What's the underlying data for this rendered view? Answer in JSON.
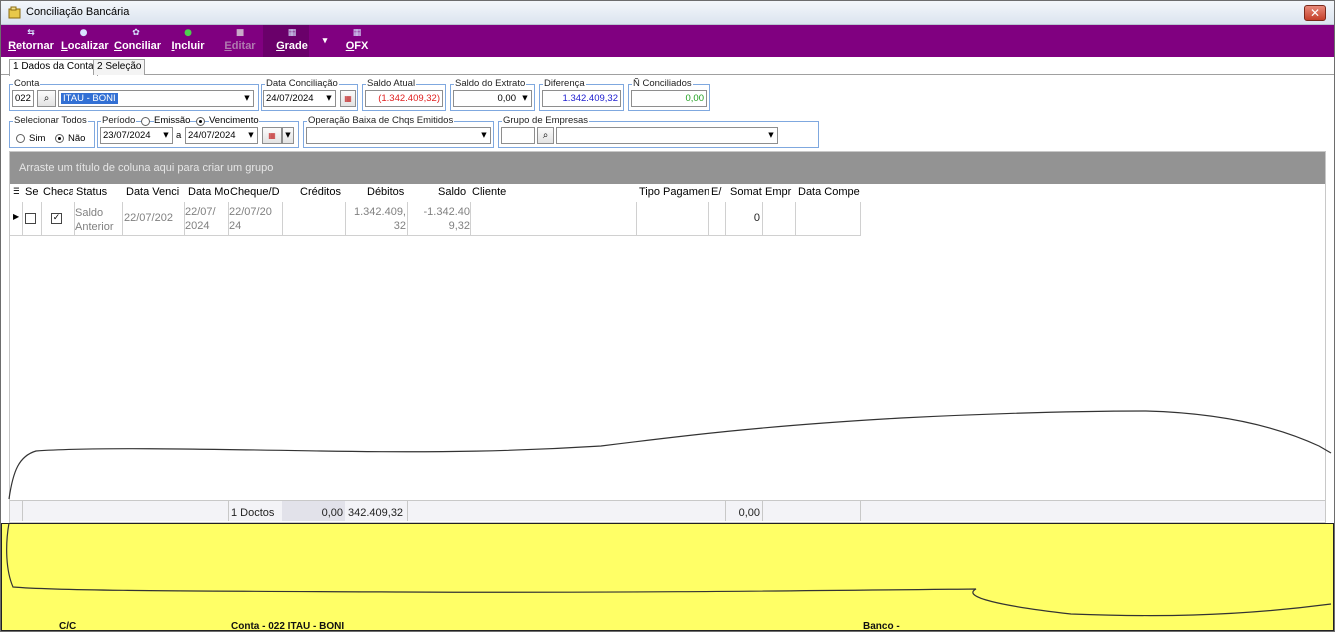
{
  "window": {
    "title": "Conciliação Bancária",
    "close_label": "✕"
  },
  "toolbar": {
    "retornar": "Retornar",
    "localizar": "Localizar",
    "conciliar": "Conciliar",
    "incluir": "Incluir",
    "editar": "Editar",
    "grade": "Grade",
    "grade_arrow": "▾",
    "ofx": "OFX"
  },
  "tabs": [
    "1 Dados da Conta",
    "2 Seleção"
  ],
  "conta": {
    "label": "Conta",
    "code": "022",
    "name": "ITAU - BONI"
  },
  "data_conciliacao": {
    "label": "Data Conciliação",
    "value": "24/07/2024"
  },
  "saldo_atual": {
    "label": "Saldo Atual",
    "value": "(1.342.409,32)"
  },
  "saldo_extrato": {
    "label": "Saldo do Extrato",
    "value": "0,00"
  },
  "diferenca": {
    "label": "Diferença",
    "value": "1.342.409,32"
  },
  "nao_conciliados": {
    "label": "Ñ Conciliados",
    "value": "0,00"
  },
  "selecionar_todos": {
    "label": "Selecionar Todos",
    "sim": "Sim",
    "nao": "Não"
  },
  "periodo": {
    "label": "Período",
    "emissao": "Emissão",
    "vencimento": "Vencimento",
    "from": "23/07/2024",
    "sep": "a",
    "to": "24/07/2024"
  },
  "operacao": {
    "label": "Operação Baixa de Chqs Emitidos",
    "value": ""
  },
  "grupo_empresas": {
    "label": "Grupo de Empresas",
    "code": "",
    "name": ""
  },
  "grid": {
    "group_hint": "Arraste um título de coluna aqui para criar um grupo",
    "headers": [
      "Se",
      "Checa",
      "Status",
      "Data Venci",
      "Data Mo",
      "Cheque/D",
      "Créditos",
      "Débitos",
      "Saldo",
      "Cliente",
      "Tipo Pagamen",
      "E/",
      "Somat",
      "Empr",
      "Data Compe"
    ],
    "row": {
      "status": "Saldo Anterior",
      "data_venc": "22/07/202",
      "data_mov": "22/07/ 2024",
      "cheque": "22/07/20 24",
      "creditos": "",
      "debitos": "1.342.409, 32",
      "saldo": "-1.342.40 9,32",
      "cliente": "",
      "tipo": "",
      "es": "",
      "somat": "0",
      "empr": "",
      "data_comp": ""
    },
    "footer": {
      "doctos": "1 Doctos",
      "creditos": "0,00",
      "debitos": "342.409,32",
      "somat": "0,00"
    }
  },
  "status_bar": {
    "cc": "C/C",
    "conta": "Conta - 022 ITAU - BONI",
    "banco": "Banco -"
  }
}
